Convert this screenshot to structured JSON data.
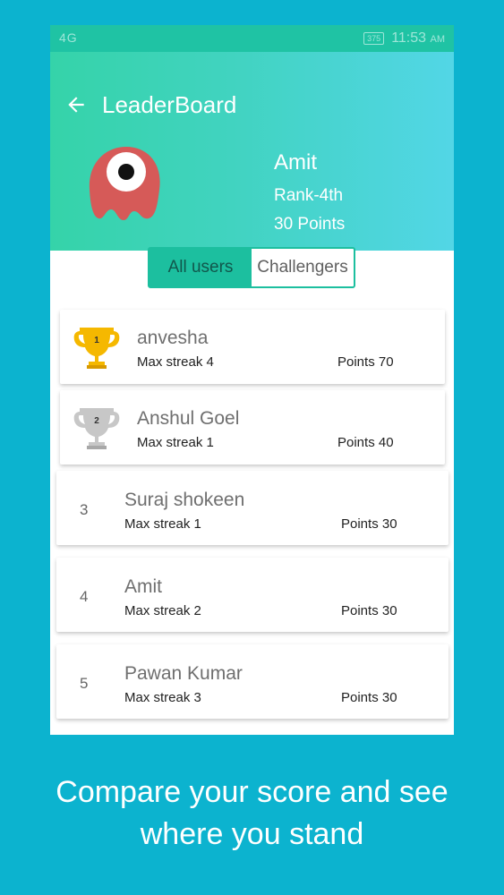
{
  "status": {
    "network": "4G",
    "battery": "375",
    "time": "11:53",
    "ampm": "AM"
  },
  "header": {
    "title": "LeaderBoard",
    "profile": {
      "name": "Amit",
      "rank": "Rank-4th",
      "points": "30 Points"
    }
  },
  "tabs": {
    "all_users": "All users",
    "challengers": "Challengers"
  },
  "leaderboard": [
    {
      "rank": "1",
      "name": "anvesha",
      "streak": "Max streak 4",
      "points": "Points 70",
      "trophy": "gold-trophy-icon"
    },
    {
      "rank": "2",
      "name": "Anshul Goel",
      "streak": "Max streak 1",
      "points": "Points 40",
      "trophy": "silver-trophy-icon"
    },
    {
      "rank": "3",
      "name": "Suraj shokeen",
      "streak": "Max streak 1",
      "points": "Points 30"
    },
    {
      "rank": "4",
      "name": "Amit",
      "streak": "Max streak 2",
      "points": "Points 30"
    },
    {
      "rank": "5",
      "name": "Pawan Kumar",
      "streak": "Max streak 3",
      "points": "Points 30"
    }
  ],
  "caption": {
    "line1": "Compare your score and see",
    "line2": "where you stand"
  },
  "colors": {
    "background": "#0cb3cf",
    "header_start": "#35d3a9",
    "header_end": "#52d6e6",
    "accent": "#1cbf9f",
    "avatar": "#d65a58"
  }
}
